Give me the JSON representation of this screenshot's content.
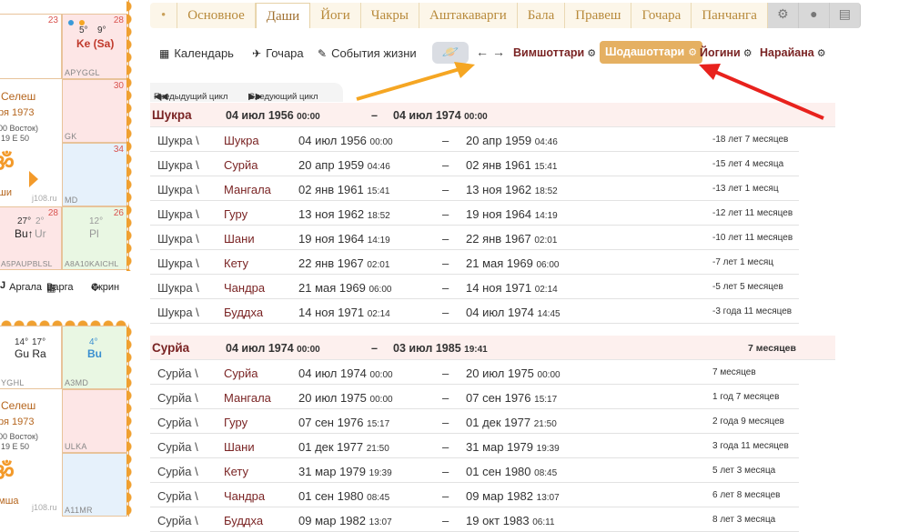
{
  "tabs": [
    {
      "label": "•",
      "kind": "dot"
    },
    {
      "label": "Основное"
    },
    {
      "label": "Даши",
      "active": true
    },
    {
      "label": "Йоги"
    },
    {
      "label": "Чакры"
    },
    {
      "label": "Аштакаварги"
    },
    {
      "label": "Бала"
    },
    {
      "label": "Правеш"
    },
    {
      "label": "Гочара"
    },
    {
      "label": "Панчанга"
    }
  ],
  "tab_icons": [
    "gear-icon",
    "globe-icon",
    "book-icon"
  ],
  "toolbar": {
    "calendar": "Календарь",
    "gochara": "Гочара",
    "life_events": "События жизни",
    "systems": {
      "vimshottari": "Вимшоттари",
      "shodashottari": "Шодашоттари",
      "yogini": "Йогини",
      "narayana": "Нарайана"
    }
  },
  "cycle_nav": {
    "prev": "Предыдущий цикл",
    "next": "Следующий цикл"
  },
  "left_panel": {
    "chart1": {
      "cell_nums": [
        "23",
        "28",
        "30",
        "34",
        "28",
        "26"
      ],
      "ke_degrees": [
        "5°",
        "9°"
      ],
      "ke_label": "Ke (Sa)",
      "ke_foot": "APYGGL",
      "gk": "GK",
      "md": "MD",
      "bu_deg": [
        "27°",
        "2°"
      ],
      "bu_label": "Bu↑",
      "ur_label": "Ur",
      "pl_deg": "12°",
      "pl_label": "Pl",
      "foot_left": "A5PAUPBLSL",
      "foot_right": "A8A10KAICHL",
      "center_name": "Селеш",
      "center_date": "ря 1973",
      "center_tz": "00 Восток)",
      "center_coord": "19 E 50",
      "center_label": "ши",
      "site": "j108.ru"
    },
    "bottom_bar": {
      "argala": "Аргала",
      "varga": "Варга",
      "screen": "Скрин"
    },
    "chart2": {
      "gura_deg": [
        "14°",
        "17°"
      ],
      "gura": "Gu Ra",
      "bu_deg": "4°",
      "bu": "Bu",
      "foot1": "YGHL",
      "foot2": "A3MD",
      "ulka": "ULKA",
      "foot3": "A11MR",
      "center_name": "Селеш",
      "center_date": "ря 1973",
      "center_tz": "00 Восток)",
      "center_coord": "19 E 50",
      "center_label": "мша",
      "site": "j108.ru"
    }
  },
  "dasha_groups": [
    {
      "planet": "Шукра",
      "start_date": "04 июл 1956",
      "start_time": "00:00",
      "end_date": "04 июл 1974",
      "end_time": "00:00",
      "duration": "",
      "rows": [
        {
          "prefix": "Шукра \\",
          "planet": "Шукра",
          "start": "04 июл 1956",
          "st": "00:00",
          "end": "20 апр 1959",
          "et": "04:46",
          "duration": "-18 лет 7 месяцев"
        },
        {
          "prefix": "Шукра \\",
          "planet": "Сурйа",
          "start": "20 апр 1959",
          "st": "04:46",
          "end": "02 янв 1961",
          "et": "15:41",
          "duration": "-15 лет 4 месяца"
        },
        {
          "prefix": "Шукра \\",
          "planet": "Мангала",
          "start": "02 янв 1961",
          "st": "15:41",
          "end": "13 ноя 1962",
          "et": "18:52",
          "duration": "-13 лет 1 месяц"
        },
        {
          "prefix": "Шукра \\",
          "planet": "Гуру",
          "start": "13 ноя 1962",
          "st": "18:52",
          "end": "19 ноя 1964",
          "et": "14:19",
          "duration": "-12 лет 11 месяцев"
        },
        {
          "prefix": "Шукра \\",
          "planet": "Шани",
          "start": "19 ноя 1964",
          "st": "14:19",
          "end": "22 янв 1967",
          "et": "02:01",
          "duration": "-10 лет 11 месяцев"
        },
        {
          "prefix": "Шукра \\",
          "planet": "Кету",
          "start": "22 янв 1967",
          "st": "02:01",
          "end": "21 мая 1969",
          "et": "06:00",
          "duration": "-7 лет 1 месяц"
        },
        {
          "prefix": "Шукра \\",
          "planet": "Чандра",
          "start": "21 мая 1969",
          "st": "06:00",
          "end": "14 ноя 1971",
          "et": "02:14",
          "duration": "-5 лет 5 месяцев"
        },
        {
          "prefix": "Шукра \\",
          "planet": "Буддха",
          "start": "14 ноя 1971",
          "st": "02:14",
          "end": "04 июл 1974",
          "et": "14:45",
          "duration": "-3 года 11 месяцев"
        }
      ]
    },
    {
      "planet": "Сурйа",
      "start_date": "04 июл 1974",
      "start_time": "00:00",
      "end_date": "03 июл 1985",
      "end_time": "19:41",
      "duration": "7 месяцев",
      "rows": [
        {
          "prefix": "Сурйа \\",
          "planet": "Сурйа",
          "start": "04 июл 1974",
          "st": "00:00",
          "end": "20 июл 1975",
          "et": "00:00",
          "duration": "7 месяцев"
        },
        {
          "prefix": "Сурйа \\",
          "planet": "Мангала",
          "start": "20 июл 1975",
          "st": "00:00",
          "end": "07 сен 1976",
          "et": "15:17",
          "duration": "1 год 7 месяцев"
        },
        {
          "prefix": "Сурйа \\",
          "planet": "Гуру",
          "start": "07 сен 1976",
          "st": "15:17",
          "end": "01 дек 1977",
          "et": "21:50",
          "duration": "2 года 9 месяцев"
        },
        {
          "prefix": "Сурйа \\",
          "planet": "Шани",
          "start": "01 дек 1977",
          "st": "21:50",
          "end": "31 мар 1979",
          "et": "19:39",
          "duration": "3 года 11 месяцев"
        },
        {
          "prefix": "Сурйа \\",
          "planet": "Кету",
          "start": "31 мар 1979",
          "st": "19:39",
          "end": "01 сен 1980",
          "et": "08:45",
          "duration": "5 лет 3 месяца"
        },
        {
          "prefix": "Сурйа \\",
          "planet": "Чандра",
          "start": "01 сен 1980",
          "st": "08:45",
          "end": "09 мар 1982",
          "et": "13:07",
          "duration": "6 лет 8 месяцев"
        },
        {
          "prefix": "Сурйа \\",
          "planet": "Буддха",
          "start": "09 мар 1982",
          "st": "13:07",
          "end": "19 окт 1983",
          "et": "06:11",
          "duration": "8 лет 3 месяца"
        }
      ]
    }
  ],
  "colors": {
    "accent": "#e5b062",
    "planet_text": "#7a2424",
    "header_bg": "#fdf0ee",
    "orange_arrow": "#f5a623",
    "red_arrow": "#e8221d"
  }
}
